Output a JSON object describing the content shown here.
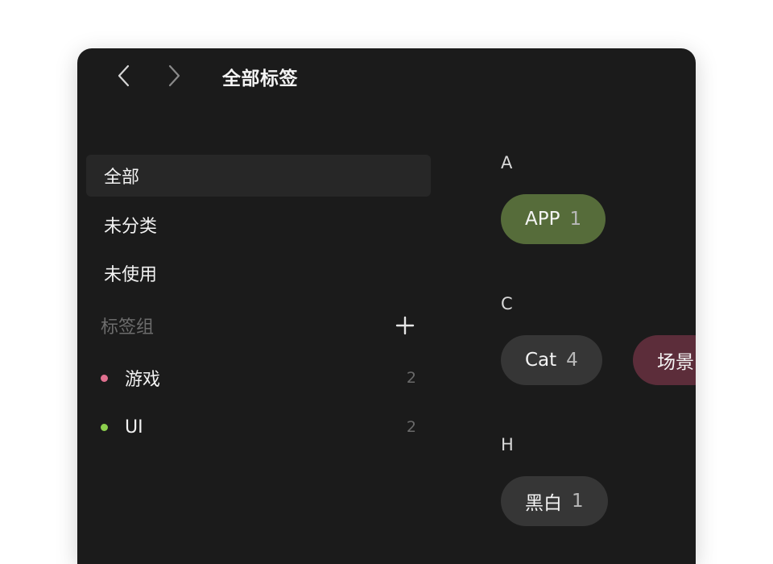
{
  "header": {
    "title": "全部标签"
  },
  "sidebar": {
    "items": [
      {
        "label": "全部",
        "active": true
      },
      {
        "label": "未分类",
        "active": false
      },
      {
        "label": "未使用",
        "active": false
      }
    ],
    "group_header": {
      "label": "标签组",
      "add_icon": "plus-icon"
    },
    "groups": [
      {
        "label": "游戏",
        "count": "2",
        "color": "#e0708f"
      },
      {
        "label": "UI",
        "count": "2",
        "color": "#8ccf4d"
      }
    ]
  },
  "tags": {
    "sections": [
      {
        "letter": "A",
        "chips": [
          {
            "name": "APP",
            "count": "1",
            "color": "#566c3a"
          }
        ]
      },
      {
        "letter": "C",
        "chips": [
          {
            "name": "Cat",
            "count": "4",
            "color": "#363636"
          },
          {
            "name": "场景",
            "count": "",
            "color": "#5c2d3a"
          }
        ]
      },
      {
        "letter": "H",
        "chips": [
          {
            "name": "黑白",
            "count": "1",
            "color": "#363636"
          }
        ]
      }
    ]
  },
  "colors": {
    "window_bg": "#1b1b1b",
    "active_item_bg": "#272727"
  }
}
